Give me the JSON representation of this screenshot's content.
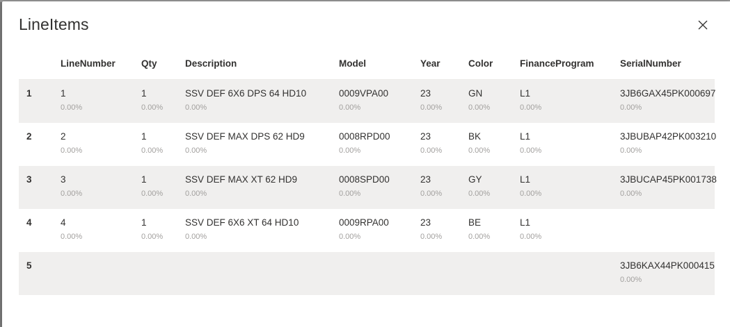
{
  "dialog": {
    "title": "LineItems"
  },
  "columns": [
    {
      "key": "LineNumber",
      "label": "LineNumber"
    },
    {
      "key": "Qty",
      "label": "Qty"
    },
    {
      "key": "Description",
      "label": "Description"
    },
    {
      "key": "Model",
      "label": "Model"
    },
    {
      "key": "Year",
      "label": "Year"
    },
    {
      "key": "Color",
      "label": "Color"
    },
    {
      "key": "FinanceProgram",
      "label": "FinanceProgram"
    },
    {
      "key": "SerialNumber",
      "label": "SerialNumber"
    }
  ],
  "rows": [
    {
      "num": "1",
      "cells": [
        {
          "value": "1",
          "pct": "0.00%"
        },
        {
          "value": "1",
          "pct": "0.00%"
        },
        {
          "value": "SSV DEF 6X6 DPS 64 HD10",
          "pct": "0.00%"
        },
        {
          "value": "0009VPA00",
          "pct": "0.00%"
        },
        {
          "value": "23",
          "pct": "0.00%"
        },
        {
          "value": "GN",
          "pct": "0.00%"
        },
        {
          "value": "L1",
          "pct": "0.00%"
        },
        {
          "value": "3JB6GAX45PK000697",
          "pct": "0.00%"
        }
      ]
    },
    {
      "num": "2",
      "cells": [
        {
          "value": "2",
          "pct": "0.00%"
        },
        {
          "value": "1",
          "pct": "0.00%"
        },
        {
          "value": "SSV DEF MAX DPS 62 HD9",
          "pct": "0.00%"
        },
        {
          "value": "0008RPD00",
          "pct": "0.00%"
        },
        {
          "value": "23",
          "pct": "0.00%"
        },
        {
          "value": "BK",
          "pct": "0.00%"
        },
        {
          "value": "L1",
          "pct": "0.00%"
        },
        {
          "value": "3JBUBAP42PK003210",
          "pct": "0.00%"
        }
      ]
    },
    {
      "num": "3",
      "cells": [
        {
          "value": "3",
          "pct": "0.00%"
        },
        {
          "value": "1",
          "pct": "0.00%"
        },
        {
          "value": "SSV DEF MAX XT 62 HD9",
          "pct": "0.00%"
        },
        {
          "value": "0008SPD00",
          "pct": "0.00%"
        },
        {
          "value": "23",
          "pct": "0.00%"
        },
        {
          "value": "GY",
          "pct": "0.00%"
        },
        {
          "value": "L1",
          "pct": "0.00%"
        },
        {
          "value": "3JBUCAP45PK001738",
          "pct": "0.00%"
        }
      ]
    },
    {
      "num": "4",
      "cells": [
        {
          "value": "4",
          "pct": "0.00%"
        },
        {
          "value": "1",
          "pct": "0.00%"
        },
        {
          "value": "SSV DEF 6X6 XT 64 HD10",
          "pct": "0.00%"
        },
        {
          "value": "0009RPA00",
          "pct": "0.00%"
        },
        {
          "value": "23",
          "pct": "0.00%"
        },
        {
          "value": "BE",
          "pct": "0.00%"
        },
        {
          "value": "L1",
          "pct": "0.00%"
        },
        {
          "value": "",
          "pct": ""
        }
      ]
    },
    {
      "num": "5",
      "cells": [
        {
          "value": "",
          "pct": ""
        },
        {
          "value": "",
          "pct": ""
        },
        {
          "value": "",
          "pct": ""
        },
        {
          "value": "",
          "pct": ""
        },
        {
          "value": "",
          "pct": ""
        },
        {
          "value": "",
          "pct": ""
        },
        {
          "value": "",
          "pct": ""
        },
        {
          "value": "3JB6KAX44PK000415",
          "pct": "0.00%"
        }
      ]
    }
  ]
}
